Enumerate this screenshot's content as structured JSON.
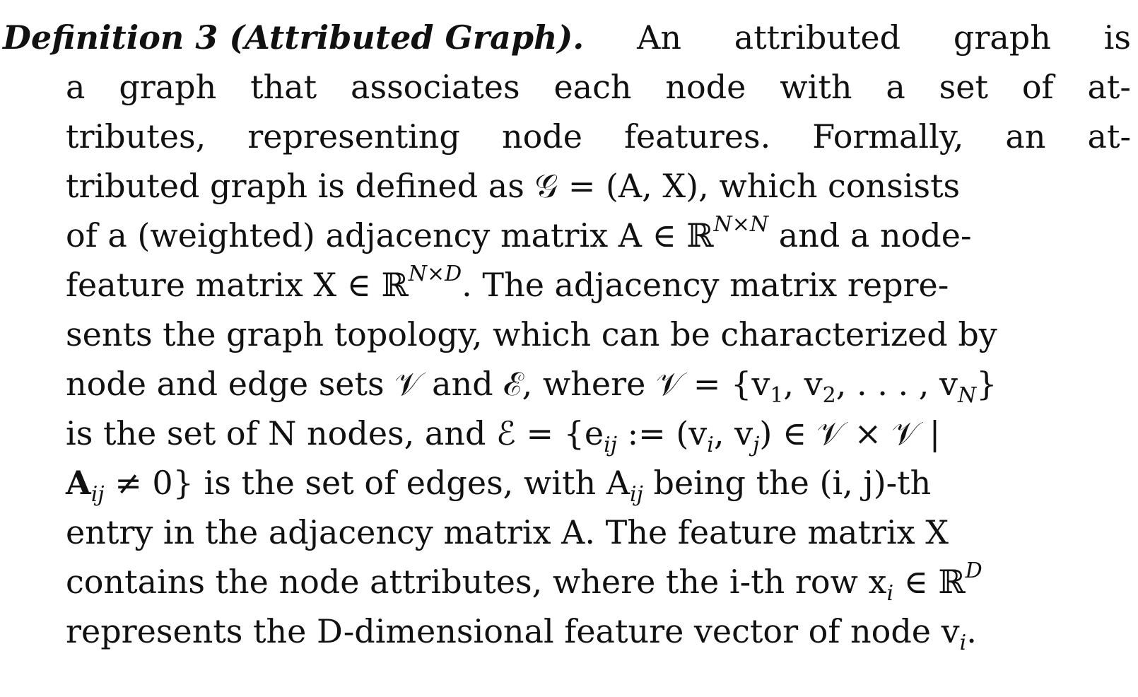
{
  "heading": "Definition 3 (Attributed Graph).",
  "lines": [
    [
      "An",
      "attributed",
      "graph",
      "is"
    ],
    [
      "a",
      "graph",
      "that",
      "associates",
      "each",
      "node",
      "with",
      "a",
      "set",
      "of",
      "at-"
    ],
    [
      "tributes,",
      "representing",
      "node",
      "features.",
      "Formally,",
      "an",
      "at-"
    ],
    [
      "tributed graph is defined as 𝒢 = (A, X), which consists"
    ],
    [
      "of a (weighted) adjacency matrix A ∈ ℝ",
      "N×N",
      " and a node-"
    ],
    [
      "feature matrix X ∈ ℝ",
      "N×D",
      ". The adjacency matrix repre-"
    ],
    [
      "sents the graph topology, which can be characterized by"
    ],
    [
      "node and edge sets 𝒱 and ℰ, where 𝒱 = {v",
      "1",
      ", v",
      "2",
      ", . . . , v",
      "N",
      "}"
    ],
    [
      "is the set of N nodes, and ℰ = {e",
      "ij",
      " := (v",
      "i",
      ", v",
      "j",
      ") ∈ 𝒱 × 𝒱 |"
    ],
    [
      "A",
      "ij",
      " ≠ 0} is the set of edges, with A",
      "ij",
      " being the (i, j)-th"
    ],
    [
      "entry in the adjacency matrix A. The feature matrix X"
    ],
    [
      "contains the node attributes, where the i-th row x",
      "i",
      " ∈ ℝ",
      "D"
    ],
    [
      "represents the D-dimensional feature vector of node v",
      "i",
      "."
    ]
  ]
}
